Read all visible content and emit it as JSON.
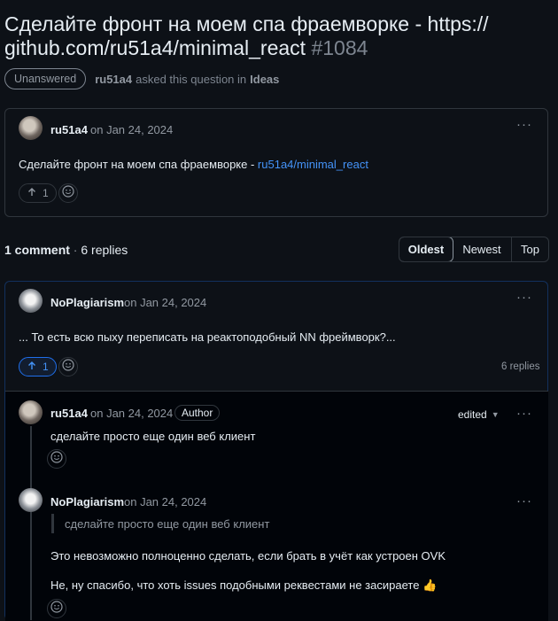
{
  "title": {
    "text": "Сделайте фронт на моем спа фраемворке - https:// github.com/ru51a4/minimal_react",
    "number": "#1084"
  },
  "meta": {
    "status": "Unanswered",
    "author": "ru51a4",
    "asked_text": "asked this question in",
    "category": "Ideas"
  },
  "question": {
    "author": "ru51a4",
    "date": "on Jan 24, 2024",
    "text_prefix": "Сделайте фронт на моем спа фраемворке - ",
    "link_text": "ru51a4/minimal_react",
    "votes": "1"
  },
  "comments_header": {
    "count": "1 comment",
    "sep": " · ",
    "replies": "6 replies"
  },
  "sort": {
    "options": [
      "Oldest",
      "Newest",
      "Top"
    ],
    "selected": "Oldest"
  },
  "comment": {
    "author": "NoPlagiarism",
    "date": "on Jan 24, 2024",
    "text": "... То есть всю пыху переписать на реактоподобный NN фреймворк?...",
    "votes": "1",
    "replies_count": "6 replies"
  },
  "replies": [
    {
      "author": "ru51a4",
      "date": "on Jan 24, 2024",
      "badge": "Author",
      "edited": "edited",
      "text": "сделайте просто еще один веб клиент"
    },
    {
      "author": "NoPlagiarism",
      "date": "on Jan 24, 2024",
      "quote": "сделайте просто еще один веб клиент",
      "text1": "Это невозможно полноценно сделать, если брать в учёт как устроен OVK",
      "text2": "Не, ну спасибо, что хоть issues подобными реквестами не засираете 👍"
    }
  ],
  "icons": {
    "kebab": "kebab-icon",
    "upvote": "arrow-up-icon",
    "emoji": "smiley-icon",
    "caret": "caret-down-icon"
  },
  "colors": {
    "bg": "#0d1117",
    "link": "#4493f8",
    "border": "#30363d",
    "muted": "#9198a1"
  }
}
